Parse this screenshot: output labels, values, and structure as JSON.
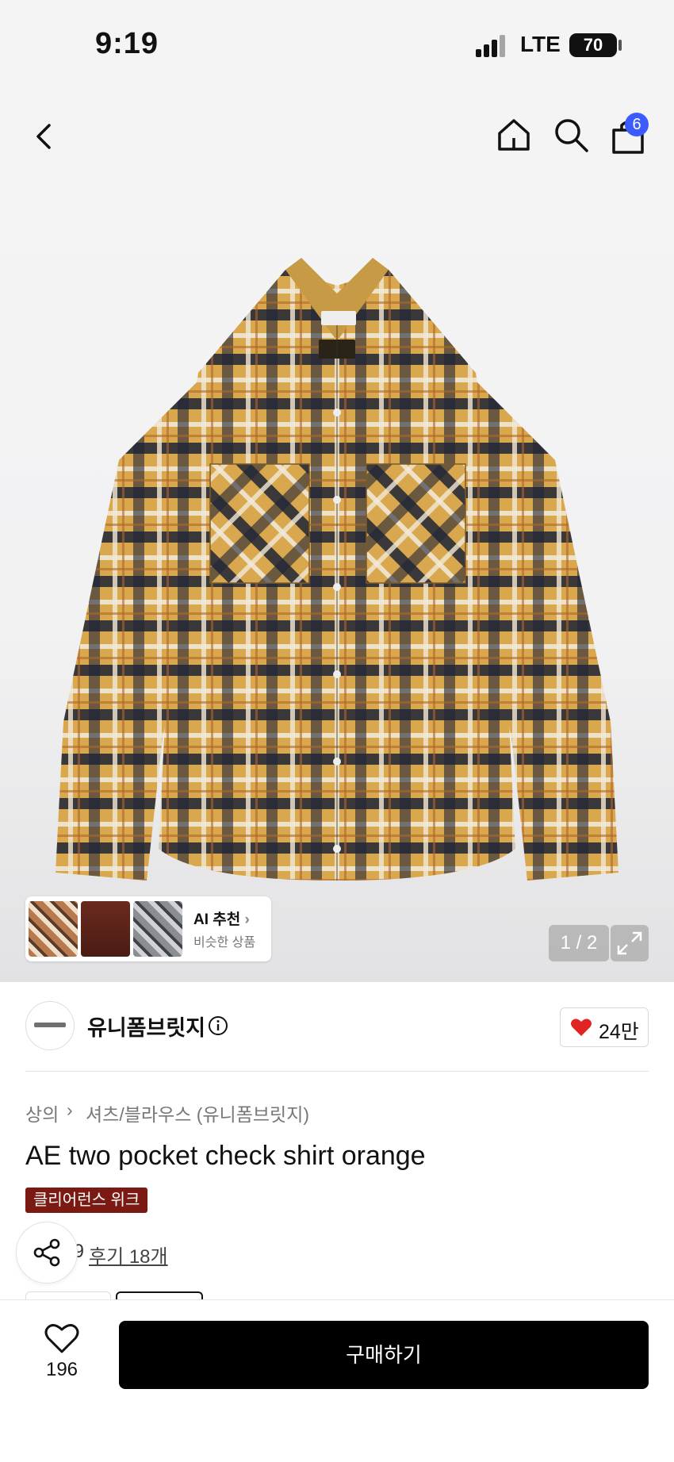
{
  "status_bar": {
    "time": "9:19",
    "network": "LTE",
    "battery": "70"
  },
  "header": {
    "cart_count": "6"
  },
  "gallery": {
    "ai_title": "AI 추천",
    "ai_subtitle": "비슷한 상품",
    "page_indicator": "1 / 2"
  },
  "brand": {
    "name": "유니폼브릿지",
    "likes": "24만"
  },
  "breadcrumb": {
    "category": "상의",
    "subcategory": "셔츠/블라우스 (유니폼브릿지)"
  },
  "product": {
    "title": "AE two pocket check shirt orange",
    "promo_badge": "클리어런스 위크",
    "rating_partial": ".9",
    "review_link": "후기 18개"
  },
  "bottom_bar": {
    "wish_count": "196",
    "buy_label": "구매하기"
  },
  "colors": {
    "accent_badge": "#3b5bfd",
    "promo_bg": "#7b1a12",
    "heart": "#e02424"
  }
}
